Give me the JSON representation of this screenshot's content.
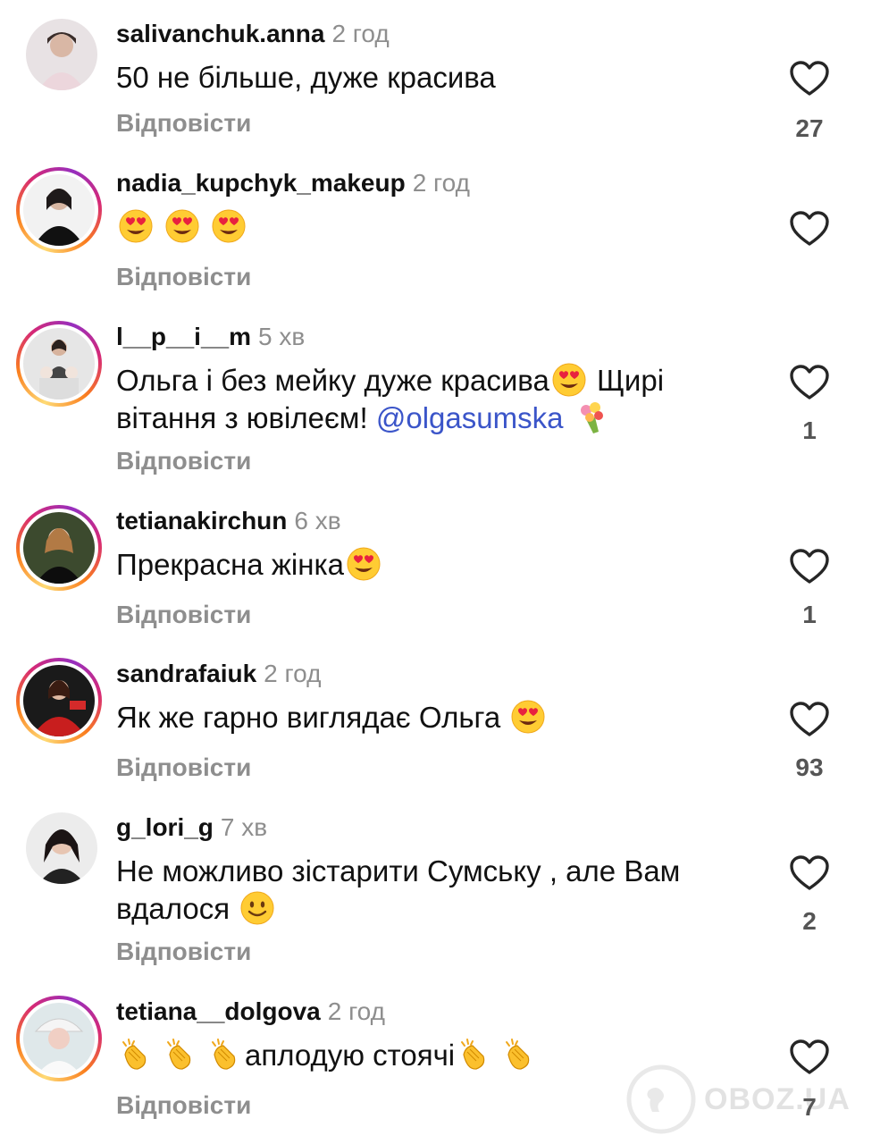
{
  "reply_label": "Відповісти",
  "colors": {
    "username": "#111111",
    "time": "#8e8e8e",
    "mention": "#3b55c9",
    "heart": "#262626"
  },
  "comments": [
    {
      "username": "salivanchuk.anna",
      "time": "2 год",
      "text": "50 не більше, дуже красива",
      "likes": "27"
    },
    {
      "username": "nadia_kupchyk_makeup",
      "time": "2 год",
      "text": "",
      "likes": ""
    },
    {
      "username": "l__p__i__m",
      "time": "5 хв",
      "text_part1": "Ольга і без мейку дуже красива",
      "text_part2": " Щирі вітання з ювілеєм! ",
      "mention": "@olgasumska",
      "likes": "1"
    },
    {
      "username": "tetianakirchun",
      "time": "6 хв",
      "text": "Прекрасна жінка",
      "likes": "1"
    },
    {
      "username": "sandrafaiuk",
      "time": "2 год",
      "text": "Як же гарно виглядає Ольга ",
      "likes": "93"
    },
    {
      "username": "g_lori_g",
      "time": "7 хв",
      "text": "Не можливо зістарити Сумську , але Вам вдалося ",
      "likes": "2"
    },
    {
      "username": "tetiana__dolgova",
      "time": "2 год",
      "text": "аплодую стоячі",
      "likes": "7"
    }
  ],
  "watermark": "OBOZ.UA"
}
